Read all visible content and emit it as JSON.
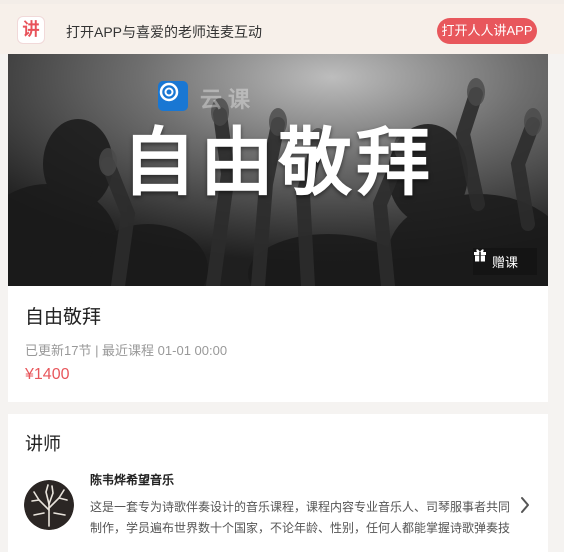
{
  "app_banner": {
    "logo_char": "讲",
    "text": "打开APP与喜爱的老师连麦互动",
    "button_label": "打开人人讲APP"
  },
  "cover": {
    "title": "自由敬拜",
    "watermark_text": "云课",
    "gift_label": "赠课"
  },
  "course": {
    "title": "自由敬拜",
    "meta": "已更新17节 | 最近课程 01-01 00:00",
    "price": "¥1400"
  },
  "teacher_section": {
    "heading": "讲师",
    "name": "陈韦烨希望音乐",
    "description_lines": [
      "这是一套专为诗歌伴奏设计的音乐课程，课程内容专业音乐人、司琴服事者共同",
      "制作，学员遍布世界数十个国家，不论年龄、性别，任何人都能掌握诗歌弹奏技"
    ]
  },
  "colors": {
    "accent": "#e8575c",
    "banner_bg": "#f7f0ea",
    "page_bg": "#f5f3f1"
  }
}
